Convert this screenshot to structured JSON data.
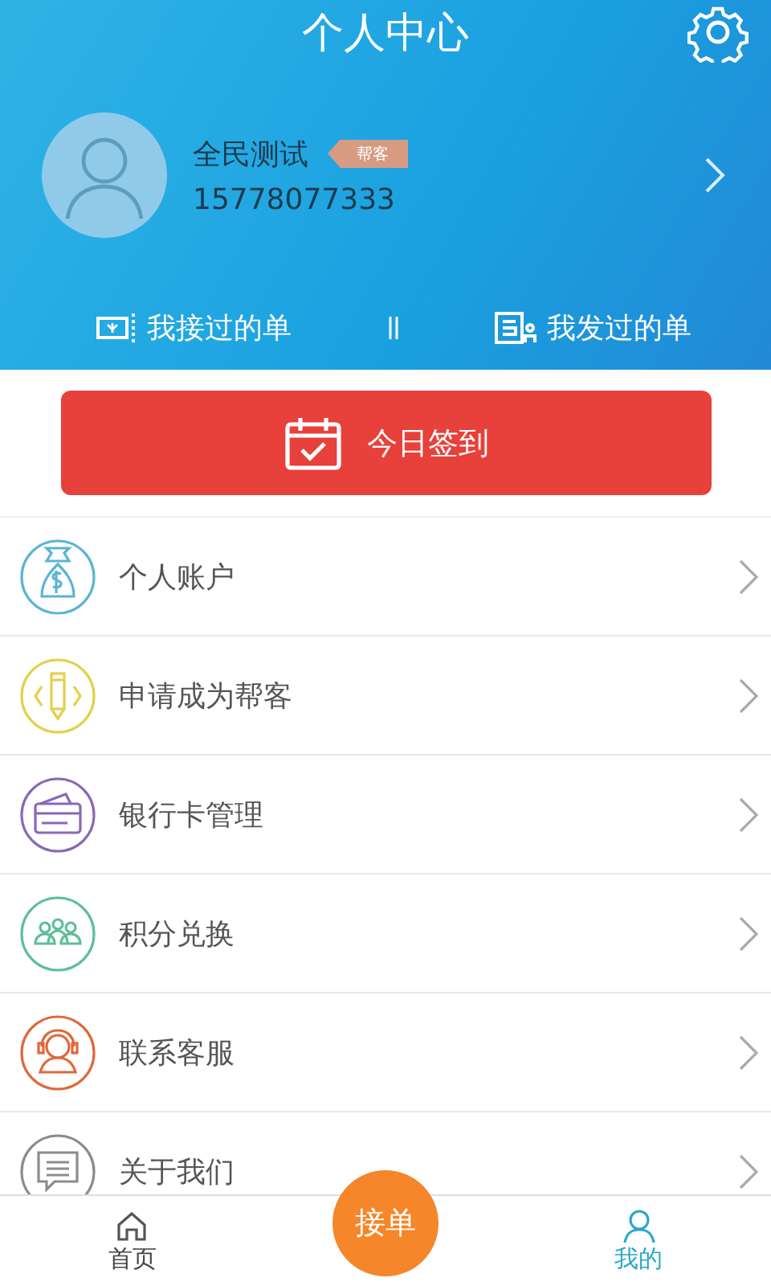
{
  "header": {
    "title": "个人中心"
  },
  "profile": {
    "name": "全民测试",
    "badge": "帮客",
    "phone": "15778077333"
  },
  "order_links": [
    {
      "kind": "received",
      "label": "我接过的单"
    },
    {
      "kind": "sent",
      "label": "我发过的单"
    }
  ],
  "sign_in": {
    "label": "今日签到"
  },
  "menu": [
    {
      "kind": "money",
      "label": "个人账户",
      "color": "#5bb4d6"
    },
    {
      "kind": "pencil",
      "label": "申请成为帮客",
      "color": "#e6cf4a"
    },
    {
      "kind": "card",
      "label": "银行卡管理",
      "color": "#8a67b8"
    },
    {
      "kind": "people",
      "label": "积分兑换",
      "color": "#5cbf9a"
    },
    {
      "kind": "service",
      "label": "联系客服",
      "color": "#e0683a"
    },
    {
      "kind": "chat",
      "label": "关于我们",
      "color": "#8c8c8c"
    }
  ],
  "tabs": [
    {
      "kind": "home",
      "label": "首页",
      "selected": false
    },
    {
      "kind": "center",
      "label": "接单",
      "selected": false
    },
    {
      "kind": "me",
      "label": "我的",
      "selected": true
    }
  ]
}
